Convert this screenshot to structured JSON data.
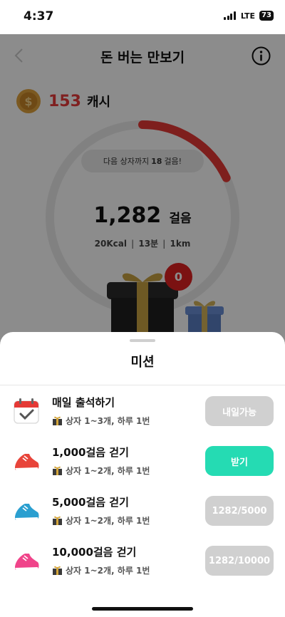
{
  "status_bar": {
    "time": "4:37",
    "network": "LTE",
    "battery": "73"
  },
  "header": {
    "title": "돈 버는 만보기",
    "back_icon": "chevron-left-icon",
    "info_icon": "info-icon"
  },
  "cash": {
    "amount": "153",
    "unit": "캐시",
    "icon": "coin-icon"
  },
  "progress": {
    "next_box_prefix": "다음 상자까지",
    "next_box_steps": "18",
    "next_box_suffix": "걸음!",
    "steps": "1,282",
    "steps_unit": "걸음",
    "kcal": "20Kcal",
    "minutes": "13분",
    "distance": "1km",
    "ring_fraction": 0.18,
    "ring_color": "#e53935",
    "box_count": "0"
  },
  "sheet": {
    "title": "미션",
    "missions": [
      {
        "icon": "calendar-check-icon",
        "name": "매일 출석하기",
        "reward": "상자 1~3개, 하루 1번",
        "button": "내일가능",
        "state": "disabled"
      },
      {
        "icon": "red-shoe-icon",
        "name": "1,000걸음 걷기",
        "reward": "상자 1~2개, 하루 1번",
        "button": "받기",
        "state": "active"
      },
      {
        "icon": "blue-shoe-icon",
        "name": "5,000걸음 걷기",
        "reward": "상자 1~2개, 하루 1번",
        "button": "1282/5000",
        "state": "disabled"
      },
      {
        "icon": "pink-shoe-icon",
        "name": "10,000걸음 걷기",
        "reward": "상자 1~2개, 하루 1번",
        "button": "1282/10000",
        "state": "disabled"
      }
    ]
  },
  "colors": {
    "accent_green": "#25dbb3",
    "disabled_grey": "#d0d0d0",
    "cash_red": "#e83b3b"
  }
}
